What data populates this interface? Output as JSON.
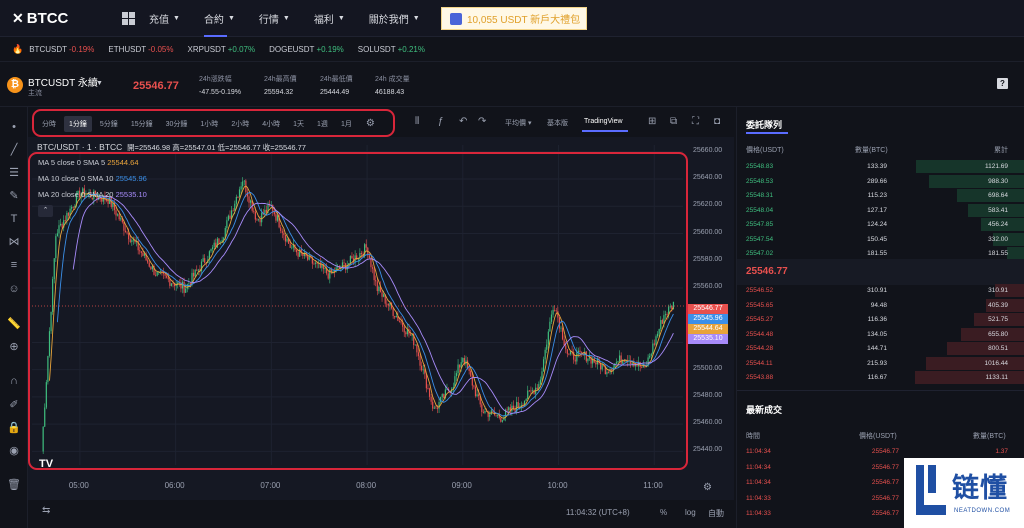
{
  "nav": {
    "brand": "BTCC",
    "items": [
      "充值",
      "合約",
      "行情",
      "福利",
      "關於我們"
    ],
    "promo": "10,055 USDT 新戶大禮包"
  },
  "ticker": [
    {
      "symbol": "BTCUSDT",
      "change": "-0.19%",
      "dir": "neg"
    },
    {
      "symbol": "ETHUSDT",
      "change": "-0.05%",
      "dir": "neg"
    },
    {
      "symbol": "XRPUSDT",
      "change": "+0.07%",
      "dir": "pos"
    },
    {
      "symbol": "DOGEUSDT",
      "change": "+0.19%",
      "dir": "pos"
    },
    {
      "symbol": "SOLUSDT",
      "change": "+0.21%",
      "dir": "pos"
    }
  ],
  "info": {
    "symbol": "BTCUSDT 永續",
    "subtitle": "主流",
    "last_price": "25546.77",
    "stats": [
      {
        "label": "24h漲跌幅",
        "value": "-47.55-0.19%",
        "red": true
      },
      {
        "label": "24h最高價",
        "value": "25594.32",
        "red": false
      },
      {
        "label": "24h最低價",
        "value": "25444.49",
        "red": false
      },
      {
        "label": "24h 成交量",
        "value": "46188.43",
        "red": false
      }
    ]
  },
  "chart_toolbar": {
    "timeframes": [
      "分時",
      "1分鐘",
      "5分鐘",
      "15分鐘",
      "30分鐘",
      "1小時",
      "2小時",
      "4小時",
      "1天",
      "1週",
      "1月"
    ],
    "active_timeframe": "1分鐘",
    "ma_type": "平均價",
    "view_basic": "基本版",
    "view_tv": "TradingView"
  },
  "chart_header": {
    "title": "BTC/USDT · 1 · BTCC",
    "ohlc": "開=25546.98 高=25547.01 低=25546.77 收=25546.77",
    "ma": [
      {
        "label": "MA 5 close 0 SMA 5",
        "value": "25544.64",
        "color": "#e8a33b"
      },
      {
        "label": "MA 10 close 0 SMA 10",
        "value": "25545.96",
        "color": "#3b8fe8"
      },
      {
        "label": "MA 20 close 0 SMA 20",
        "value": "25535.10",
        "color": "#a78bfa"
      }
    ]
  },
  "chart_data": {
    "type": "candlestick",
    "price_axis": [
      "25660.00",
      "25640.00",
      "25620.00",
      "25600.00",
      "25580.00",
      "25560.00",
      "25520.00",
      "25500.00",
      "25480.00",
      "25460.00",
      "25440.00"
    ],
    "time_axis": [
      "05:00",
      "06:00",
      "07:00",
      "08:00",
      "09:00",
      "10:00",
      "11:00"
    ],
    "ylim": [
      25430,
      25665
    ],
    "price_tags": [
      {
        "value": "25546.77",
        "color": "#e8504e"
      },
      {
        "value": "25545.96",
        "color": "#3b8fe8"
      },
      {
        "value": "25544.64",
        "color": "#e8a33b"
      },
      {
        "value": "25535.10",
        "color": "#a78bfa"
      }
    ],
    "approx_close_path": [
      [
        4.6,
        25440
      ],
      [
        4.75,
        25600
      ],
      [
        5.0,
        25630
      ],
      [
        5.3,
        25625
      ],
      [
        5.5,
        25600
      ],
      [
        5.8,
        25570
      ],
      [
        6.1,
        25560
      ],
      [
        6.3,
        25580
      ],
      [
        6.5,
        25600
      ],
      [
        6.7,
        25640
      ],
      [
        6.85,
        25610
      ],
      [
        7.0,
        25620
      ],
      [
        7.2,
        25590
      ],
      [
        7.4,
        25580
      ],
      [
        7.6,
        25570
      ],
      [
        7.8,
        25578
      ],
      [
        8.0,
        25590
      ],
      [
        8.1,
        25560
      ],
      [
        8.3,
        25540
      ],
      [
        8.5,
        25520
      ],
      [
        8.7,
        25470
      ],
      [
        8.9,
        25490
      ],
      [
        9.0,
        25510
      ],
      [
        9.2,
        25470
      ],
      [
        9.4,
        25465
      ],
      [
        9.6,
        25475
      ],
      [
        9.8,
        25490
      ],
      [
        9.95,
        25550
      ],
      [
        10.1,
        25510
      ],
      [
        10.3,
        25510
      ],
      [
        10.5,
        25500
      ],
      [
        10.7,
        25510
      ],
      [
        10.9,
        25500
      ],
      [
        11.1,
        25540
      ],
      [
        11.2,
        25548
      ]
    ]
  },
  "chart_bottom": {
    "clock": "11:04:32 (UTC+8)",
    "pct": "%",
    "log": "log",
    "auto": "自動"
  },
  "order_book": {
    "title": "委託隊列",
    "headers": [
      "價格(USDT)",
      "數量(BTC)",
      "累計"
    ],
    "asks": [
      [
        "25548.83",
        "133.39",
        "1121.69"
      ],
      [
        "25548.53",
        "289.66",
        "988.30"
      ],
      [
        "25548.31",
        "115.23",
        "698.64"
      ],
      [
        "25548.04",
        "127.17",
        "583.41"
      ],
      [
        "25547.85",
        "124.24",
        "456.24"
      ],
      [
        "25547.54",
        "150.45",
        "332.00"
      ],
      [
        "25547.02",
        "181.55",
        "181.55"
      ]
    ],
    "mid": "25546.77",
    "bids": [
      [
        "25546.52",
        "310.91",
        "310.91"
      ],
      [
        "25545.65",
        "94.48",
        "405.39"
      ],
      [
        "25545.27",
        "116.36",
        "521.75"
      ],
      [
        "25544.48",
        "134.05",
        "655.80"
      ],
      [
        "25544.28",
        "144.71",
        "800.51"
      ],
      [
        "25544.11",
        "215.93",
        "1016.44"
      ],
      [
        "25543.88",
        "116.67",
        "1133.11"
      ]
    ]
  },
  "trades": {
    "title": "最新成交",
    "headers": [
      "時間",
      "價格(USDT)",
      "數量(BTC)"
    ],
    "rows": [
      [
        "11:04:34",
        "25546.77",
        "1.37"
      ],
      [
        "11:04:34",
        "25546.77",
        "1.11"
      ],
      [
        "11:04:34",
        "25546.77",
        ""
      ],
      [
        "11:04:33",
        "25546.77",
        ""
      ],
      [
        "11:04:33",
        "25546.77",
        ""
      ]
    ]
  },
  "watermark": {
    "text": "链懂",
    "sub": "NEATDOWN.COM"
  }
}
